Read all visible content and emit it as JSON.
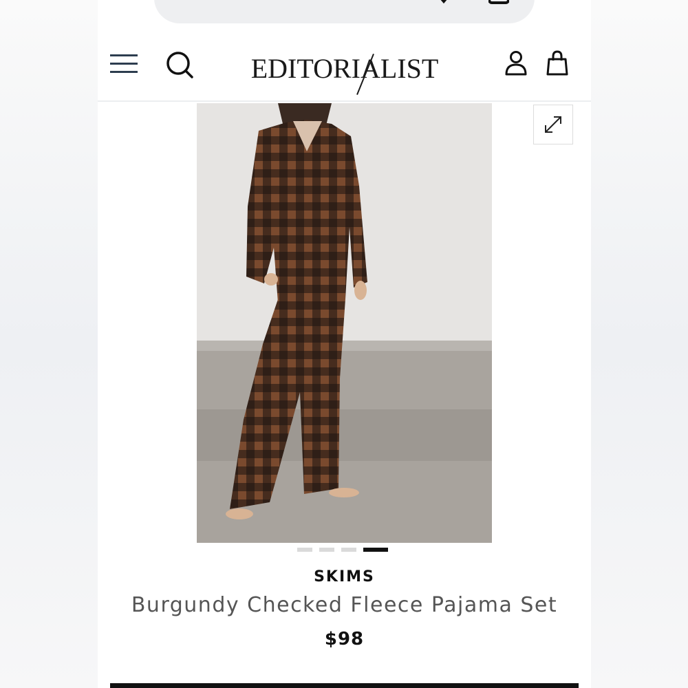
{
  "header": {
    "logo_text": "EDITORIALIST"
  },
  "icons": {
    "menu": "hamburger-menu-icon",
    "search": "search-icon",
    "account": "user-icon",
    "bag": "shopping-bag-icon",
    "expand": "expand-icon"
  },
  "gallery": {
    "total_images": 4,
    "active_index": 4
  },
  "product": {
    "brand": "SKIMS",
    "name": "Burgundy Checked Fleece Pajama Set",
    "price": "$98"
  },
  "colors": {
    "accent": "#111111",
    "muted_text": "#555555",
    "dot_inactive": "#dadada"
  }
}
